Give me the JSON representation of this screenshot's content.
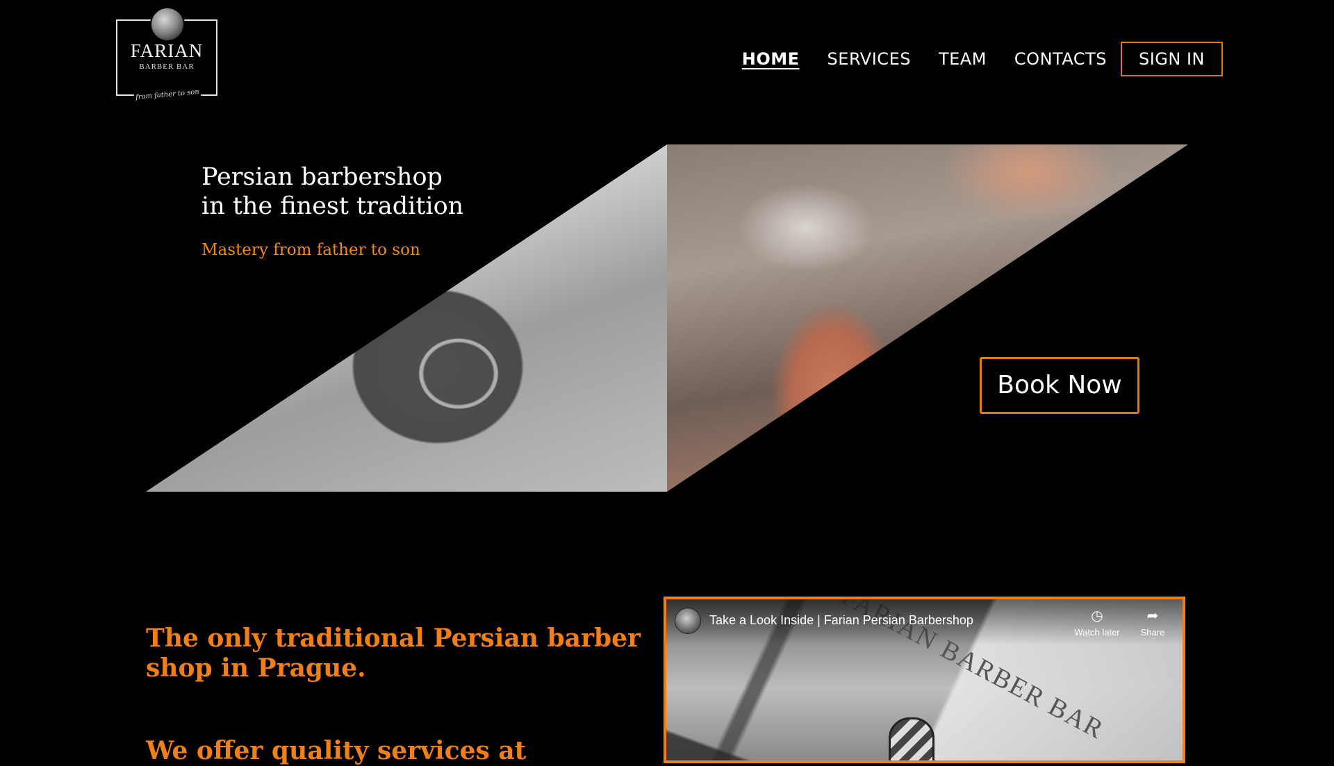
{
  "brand": {
    "name": "FARIAN",
    "subtitle": "BARBER BAR",
    "tagline": "from father to son"
  },
  "nav": {
    "items": [
      {
        "label": "HOME",
        "active": true
      },
      {
        "label": "SERVICES",
        "active": false
      },
      {
        "label": "TEAM",
        "active": false
      },
      {
        "label": "CONTACTS",
        "active": false
      }
    ],
    "sign_in": "SIGN IN"
  },
  "hero": {
    "title_line1": "Persian barbershop",
    "title_line2": "in the finest tradition",
    "subtitle": "Mastery from father to son",
    "book_button": "Book Now"
  },
  "intro": {
    "title": "The only traditional Persian barber shop in Prague.",
    "next_heading": "We offer quality services at"
  },
  "video": {
    "title": "Take a Look Inside | Farian Persian Barbershop",
    "watch_later": "Watch later",
    "share": "Share",
    "sign_text": "FARIAN BARBER BAR"
  },
  "colors": {
    "accent": "#ef7f16",
    "background": "#000000",
    "text": "#ffffff"
  },
  "icons": {
    "watch_later": "clock-icon",
    "share": "share-arrow-icon"
  }
}
